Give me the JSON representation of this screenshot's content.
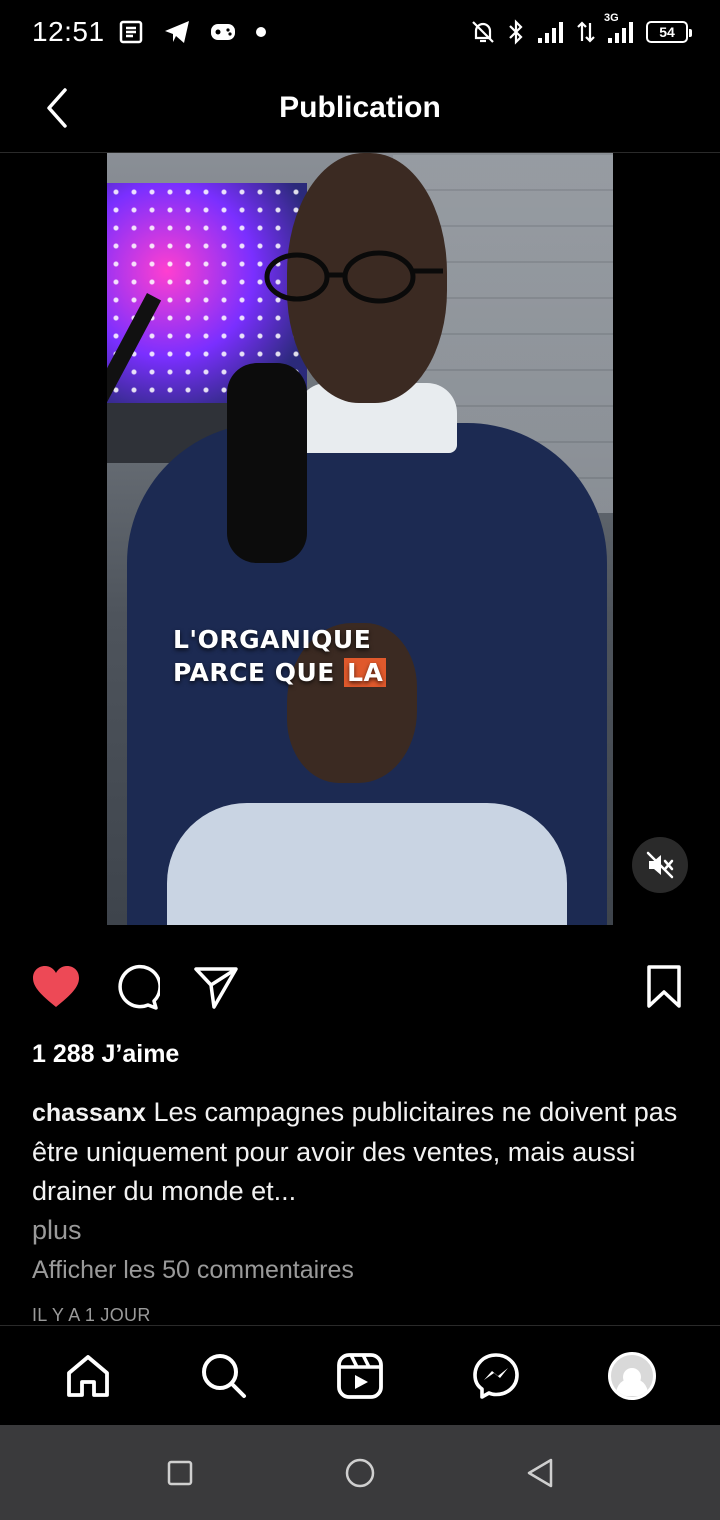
{
  "status_bar": {
    "time": "12:51",
    "network_label": "3G",
    "battery": "54",
    "icons": [
      "news-icon",
      "telegram-icon",
      "game-controller-icon",
      "dot-icon",
      "bell-off-icon",
      "bluetooth-icon",
      "signal-icon",
      "data-arrows-icon",
      "signal-3g-icon",
      "battery-icon"
    ]
  },
  "header": {
    "title": "Publication",
    "back_icon": "chevron-left-icon"
  },
  "media": {
    "overlay_line1": "L'ORGANIQUE",
    "overlay_line2_pre": "PARCE QUE ",
    "overlay_line2_highlight": "LA",
    "mute_icon": "volume-off-icon"
  },
  "actions": {
    "like_icon": "heart-filled-icon",
    "comment_icon": "comment-icon",
    "share_icon": "send-icon",
    "save_icon": "bookmark-icon",
    "like_color": "#ed4956"
  },
  "post": {
    "likes": "1 288 J’aime",
    "username": "chassanx",
    "caption": " Les campagnes publicitaires ne doivent pas être uniquement pour avoir des ventes, mais aussi drainer du monde et...",
    "more": "plus",
    "view_comments": "Afficher les 50 commentaires",
    "time_ago": "IL Y A 1 JOUR"
  },
  "bottom_nav": {
    "items": [
      "home-icon",
      "search-icon",
      "reels-icon",
      "messenger-icon",
      "profile-avatar"
    ]
  },
  "system_nav": {
    "items": [
      "recents-square-icon",
      "home-circle-icon",
      "back-triangle-icon"
    ]
  }
}
